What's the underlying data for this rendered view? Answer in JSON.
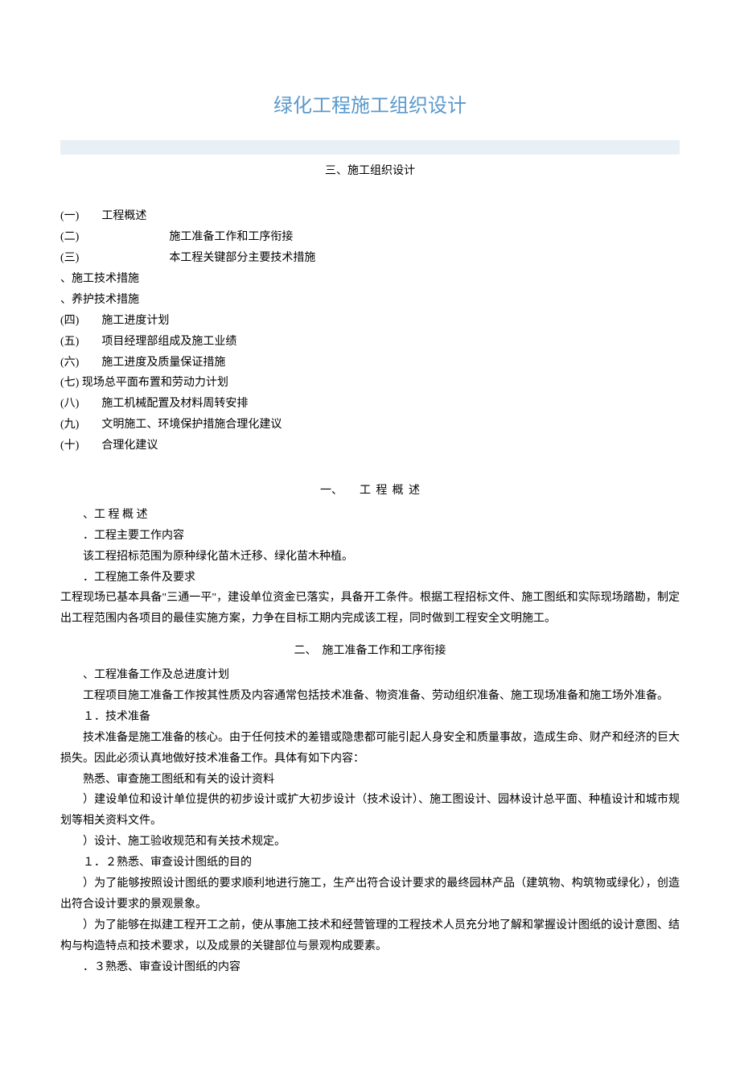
{
  "title": "绿化工程施工组织设计",
  "heading": "三、施工组织设计",
  "toc": [
    "(一)　　工程概述",
    "(二)　　　　　　　　施工准备工作和工序衔接",
    "(三)　　　　　　　　本工程关键部分主要技术措施",
    "、施工技术措施",
    "、养护技术措施",
    "(四)　　施工进度计划",
    "(五)　　项目经理部组成及施工业绩",
    "(六)　　施工进度及质量保证措施",
    "(七)  现场总平面布置和劳动力计划",
    "(八)　　施工机械配置及材料周转安排",
    "(九)　　文明施工、环境保护措施合理化建议",
    "(十)　　合理化建议"
  ],
  "section1": {
    "heading": "一、　　工 程 概 述",
    "lines": [
      "、工 程 概 述",
      "．工程主要工作内容",
      "该工程招标范围为原种绿化苗木迁移、绿化苗木种植。",
      "．工程施工条件及要求"
    ],
    "para": "工程现场已基本具备\"三通一平\"，建设单位资金已落实，具备开工条件。根据工程招标文件、施工图纸和实际现场踏勘，制定出工程范围内各项目的最佳实施方案，力争在目标工期内完成该工程，同时做到工程安全文明施工。"
  },
  "section2": {
    "heading": "二、　施工准备工作和工序衔接",
    "lines": [
      "、工程准备工作及总进度计划",
      "工程项目施工准备工作按其性质及内容通常包括技术准备、物资准备、劳动组织准备、施工现场准备和施工场外准备。",
      "１．技术准备",
      "技术准备是施工准备的核心。由于任何技术的差错或隐患都可能引起人身安全和质量事故，造成生命、财产和经济的巨大损失。因此必须认真地做好技术准备工作。具体有如下内容：",
      "熟悉、审查施工图纸和有关的设计资料",
      "）建设单位和设计单位提供的初步设计或扩大初步设计（技术设计）、施工图设计、园林设计总平面、种植设计和城市规划等相关资料文件。",
      "）设计、施工验收规范和有关技术规定。",
      "１．２熟悉、审查设计图纸的目的",
      "）为了能够按照设计图纸的要求顺利地进行施工，生产出符合设计要求的最终园林产品（建筑物、构筑物或绿化），创造出符合设计要求的景观景象。",
      "）为了能够在拟建工程开工之前，使从事施工技术和经营管理的工程技术人员充分地了解和掌握设计图纸的设计意图、结构与构造特点和技术要求，以及成景的关键部位与景观构成要素。",
      "．３熟悉、审查设计图纸的内容"
    ]
  }
}
